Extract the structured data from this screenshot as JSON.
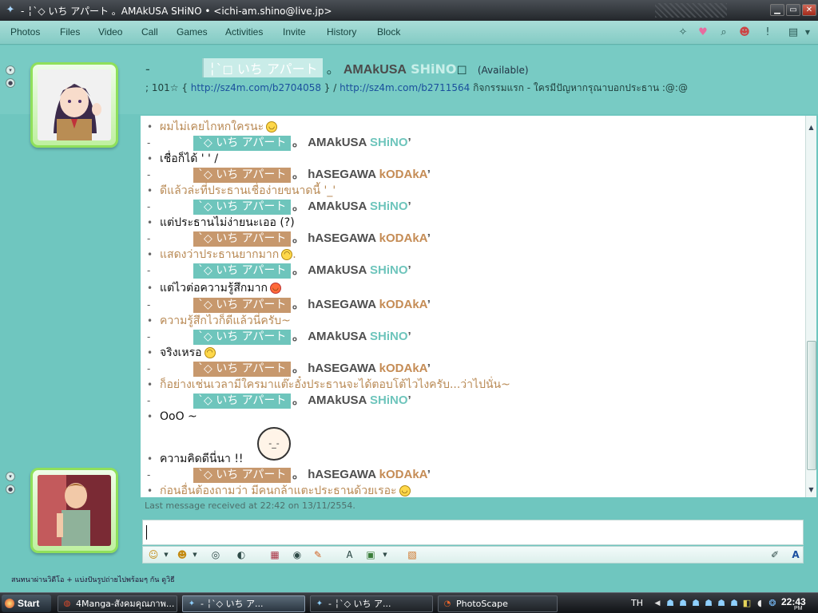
{
  "window": {
    "title": "- ╎`◇ いち アパート 。AMAkUSA SHiNO • <ichi-am.shino@live.jp>",
    "minimize": "▁",
    "maximize": "▭",
    "close": "✕"
  },
  "menu": [
    "Photos",
    "Files",
    "Video",
    "Call",
    "Games",
    "Activities",
    "Invite",
    "History",
    "Block"
  ],
  "contact": {
    "dash": "-",
    "tag": "╎`◻ いち アパート",
    "sep": "。",
    "name_a": "AMAkUSA",
    "name_b": "SHiNO",
    "name_end": "◻",
    "status": "(Available)",
    "psm_prefix": "; 101☆ { ",
    "link1": "http://sz4m.com/b2704058",
    "psm_mid": " } / ",
    "link2": "http://sz4m.com/b2711564",
    "psm_suffix": " กิจกรรมแรก   - ใครมีปัญหากรุณาบอกประธาน :@:@"
  },
  "conversation": {
    "tag_text": "`◇ いち アパート",
    "sep": "。",
    "shino_a": "AMAkUSA",
    "shino_b": "SHiNO",
    "kodaka_a": "hASEGAWA",
    "kodaka_b": "kODAkA",
    "tail": "’",
    "messages": [
      "ผมไม่เคยไกหกใครนะ",
      "เชื่อก็ได้ ' ' /",
      "ดีแล้วล่ะที่ประธานเชื่อง่ายขนาดนี้ '_'",
      "แต่ประธานไม่ง่ายนะเออ (?)",
      "แสดงว่าประธานยากมาก",
      "แต่ไวต่อความรู้สึกมาก",
      "ความรู้สึกไวก็ดีแล้วนี่ครับ~",
      "จริงเหรอ",
      "ก็อย่างเช่นเวลามีใครมาแต๊ะอั๋งประธานจะได้ตอบโต้ไวไงครับ...ว่าไปนั่น~",
      "OoO ~",
      "ความคิดดีนี่นา !!",
      "ก่อนอื่นต้องถามว่า มีคนกล้าแตะประธานด้วยเรอะ"
    ],
    "last_received": "Last message received at 22:42 on 13/11/2554."
  },
  "ad": "สนทนาผ่านวิดีโอ + แบ่งปันรูปถ่ายไปพร้อมๆ กัน ดูวิธี",
  "taskbar": {
    "start": "Start",
    "tasks": [
      "4Manga-สังคมคุณภาพ...",
      "- ╎`◇ いち ア...",
      "- ╎`◇ いち ア...",
      "PhotoScape"
    ],
    "lang": "TH",
    "time": "22:43",
    "ampm": "PM"
  },
  "colors": {
    "teal": "#6ec5bc",
    "tan": "#c7986d",
    "background": "#6fc6bf"
  }
}
